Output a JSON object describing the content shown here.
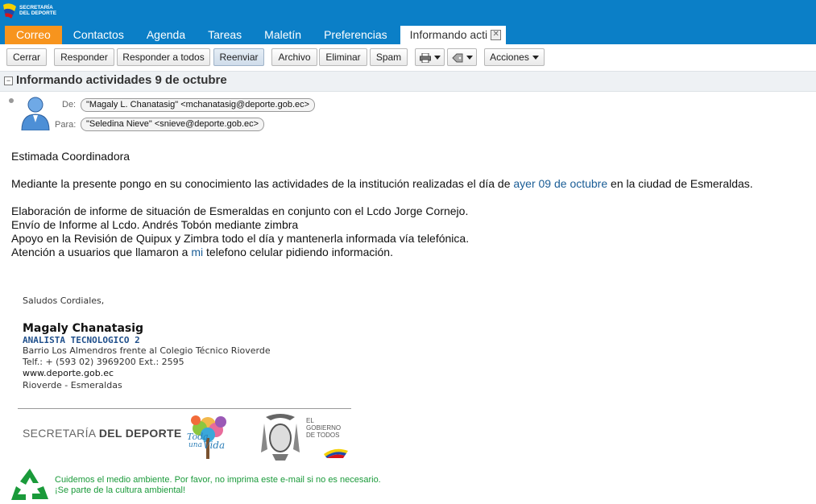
{
  "app": {
    "logo_text": [
      "SECRETARÍA",
      "DEL DEPORTE"
    ]
  },
  "tabs": [
    {
      "label": "Correo",
      "active": true
    },
    {
      "label": "Contactos"
    },
    {
      "label": "Agenda"
    },
    {
      "label": "Tareas"
    },
    {
      "label": "Maletín"
    },
    {
      "label": "Preferencias"
    },
    {
      "label": "Informando acti",
      "closable": true
    }
  ],
  "toolbar": {
    "close": "Cerrar",
    "reply": "Responder",
    "reply_all": "Responder a todos",
    "forward": "Reenviar",
    "archive": "Archivo",
    "delete": "Eliminar",
    "spam": "Spam",
    "actions": "Acciones"
  },
  "message": {
    "subject": "Informando actividades 9 de octubre",
    "from_label": "De:",
    "from": "\"Magaly L. Chanatasig\" <mchanatasig@deporte.gob.ec>",
    "to_label": "Para:",
    "to": "\"Seledina Nieve\" <snieve@deporte.gob.ec>",
    "greeting": "Estimada Coordinadora",
    "intro_before": "Mediante la presente pongo en su conocimiento las actividades de la institución realizadas el día de ",
    "intro_link": "ayer 09 de octubre",
    "intro_after": " en la ciudad de Esmeraldas.",
    "lines": [
      "Elaboración de informe de situación de Esmeraldas en conjunto con el Lcdo Jorge Cornejo.",
      "Envío de Informe al Lcdo. Andrés Tobón mediante zimbra",
      "Apoyo en la Revisión de Quipux y Zimbra todo el día y mantenerla informada vía telefónica."
    ],
    "last_before": "Atención a usuarios que llamaron a ",
    "last_link": "mi",
    "last_after": " telefono celular pidiendo información."
  },
  "signature": {
    "closing": "Saludos Cordiales,",
    "name": "Magaly Chanatasig",
    "title": "ANALISTA TECNOLOGICO 2",
    "address": "Barrio Los Almendros frente al Colegio Técnico Rioverde",
    "phone": "Telf.: + (593 02) 3969200 Ext.: 2595",
    "web": "www.deporte.gob.ec",
    "city": "Rioverde - Esmeraldas",
    "banner_secretaria": "SECRETARÍA",
    "banner_deporte": "DEL DEPORTE",
    "banner_toda": "Toda",
    "banner_una": "una",
    "banner_vida": "Vida",
    "banner_gob": [
      "EL",
      "GOBIERNO",
      "DE TODOS"
    ],
    "eco_line1": "Cuidemos el medio ambiente. Por favor, no imprima este e-mail si no es necesario.",
    "eco_line2": "¡Se parte de la cultura ambiental!"
  },
  "colors": {
    "topbar": "#0b7fc7",
    "active_tab": "#f7941d",
    "link": "#1a5d96",
    "eco_green": "#1a9a3a"
  }
}
